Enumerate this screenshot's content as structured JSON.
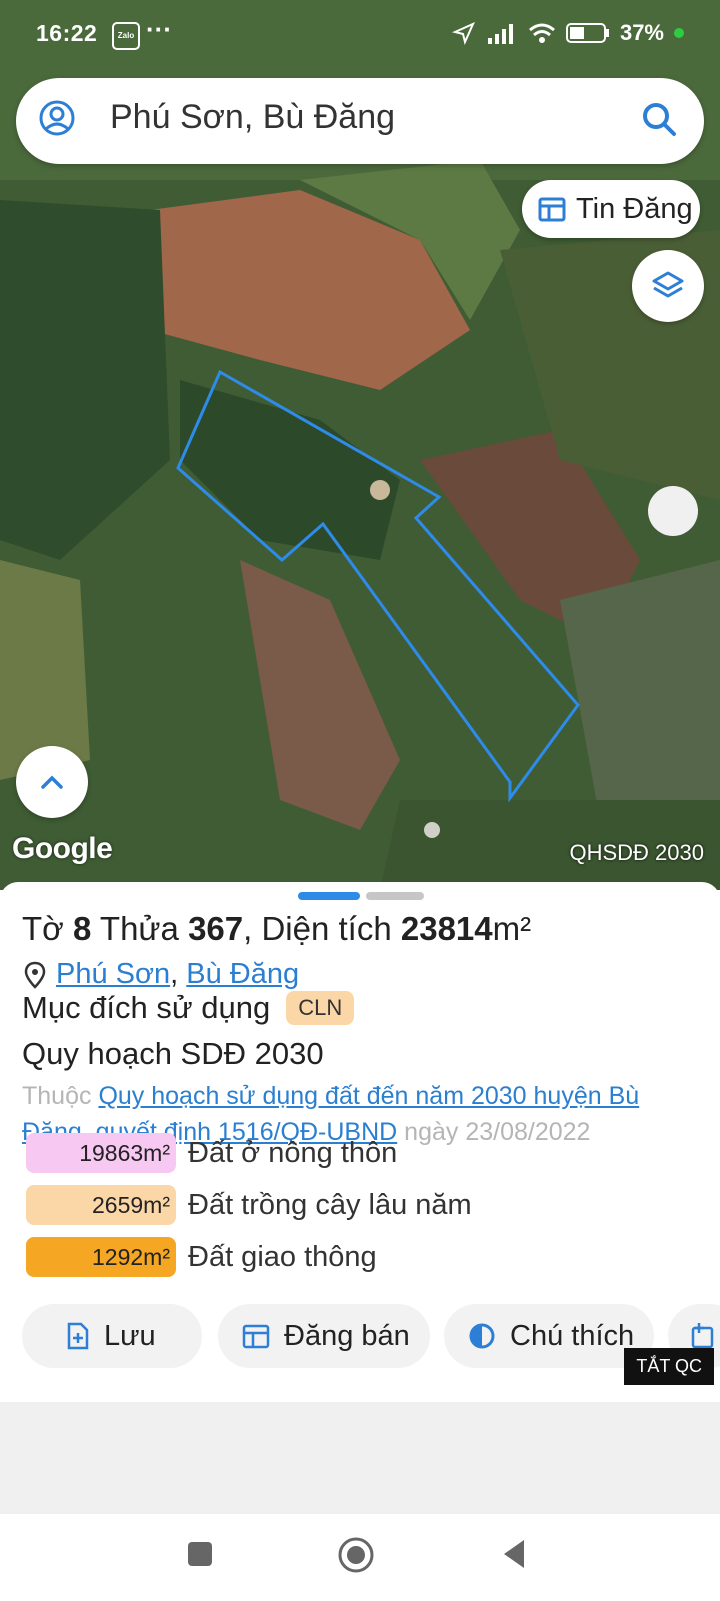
{
  "status": {
    "time": "16:22",
    "battery": "37%",
    "app_icon": "zalo-icon"
  },
  "search": {
    "value": "Phú Sơn, Bù Đăng"
  },
  "map": {
    "tin_dang_label": "Tin Đăng",
    "attribution": "Google",
    "layer_name": "QHSDĐ 2030"
  },
  "parcel": {
    "to_label": "Tờ",
    "to_value": "8",
    "thua_label": "Thửa",
    "thua_value": "367",
    "area_label": "Diện tích",
    "area_value": "23814",
    "area_unit": "m²",
    "commune": "Phú Sơn",
    "district": "Bù Đăng",
    "purpose_label": "Mục đích sử dụng",
    "purpose_code": "CLN",
    "plan_title": "Quy hoạch SDĐ 2030",
    "thuoc_label": "Thuộc",
    "plan_link": "Quy hoạch sử dụng đất đến năm 2030 huyện Bù Đăng",
    "decision_link": "quyết định 1516/QĐ-UBND",
    "date_text": "ngày 23/08/2022"
  },
  "land_use": [
    {
      "area": "19863m²",
      "label": "Đất ở nông thôn",
      "color": "#f7c8f2"
    },
    {
      "area": "2659m²",
      "label": "Đất trồng cây lâu năm",
      "color": "#fbd7a8"
    },
    {
      "area": "1292m²",
      "label": "Đất giao thông",
      "color": "#f5a623"
    }
  ],
  "actions": {
    "save": "Lưu",
    "post": "Đăng bán",
    "legend": "Chú thích"
  },
  "ad_close": "TẮT QC"
}
